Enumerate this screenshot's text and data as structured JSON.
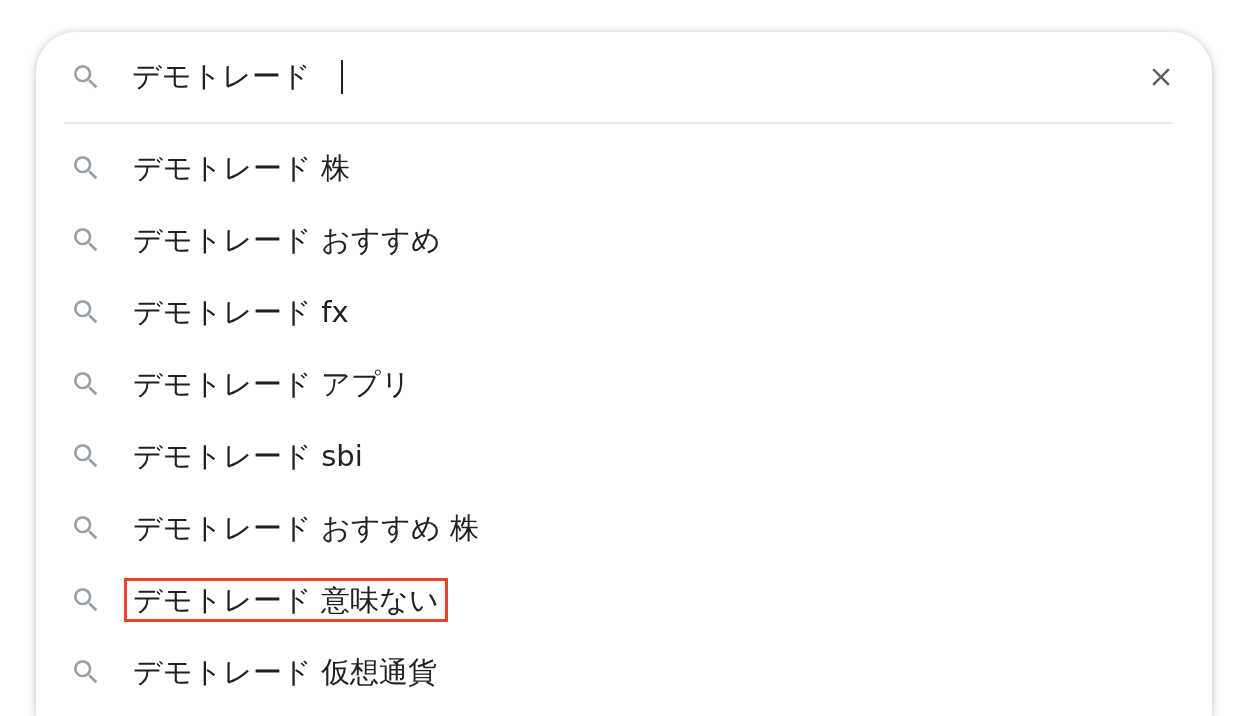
{
  "search": {
    "value": "デモトレード"
  },
  "suggestions": [
    {
      "text": "デモトレード 株",
      "highlighted": false
    },
    {
      "text": "デモトレード おすすめ",
      "highlighted": false
    },
    {
      "text": "デモトレード fx",
      "highlighted": false
    },
    {
      "text": "デモトレード アプリ",
      "highlighted": false
    },
    {
      "text": "デモトレード sbi",
      "highlighted": false
    },
    {
      "text": "デモトレード おすすめ 株",
      "highlighted": false
    },
    {
      "text": "デモトレード 意味ない",
      "highlighted": true
    },
    {
      "text": "デモトレード 仮想通貨",
      "highlighted": false
    }
  ]
}
